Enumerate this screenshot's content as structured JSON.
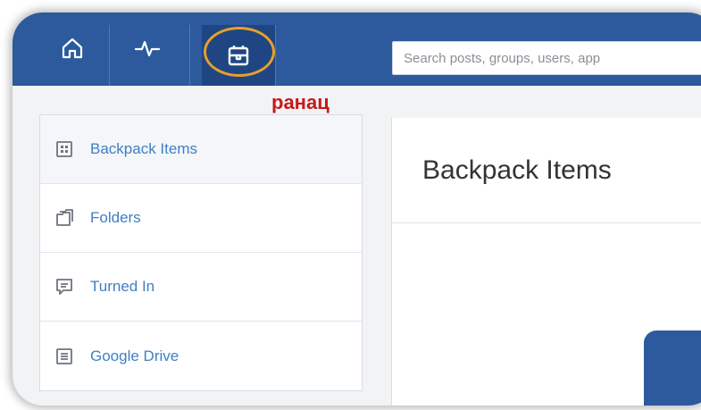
{
  "header": {
    "nav": [
      {
        "name": "home",
        "icon": "home-icon"
      },
      {
        "name": "activity",
        "icon": "activity-pulse-icon"
      },
      {
        "name": "backpack",
        "icon": "backpack-icon"
      }
    ],
    "search_placeholder": "Search posts, groups, users, app"
  },
  "annotation": {
    "text": "ранац",
    "color": "#c8191a",
    "ring_color": "#e7a02a"
  },
  "sidebar": {
    "items": [
      {
        "label": "Backpack Items",
        "icon": "grid-icon",
        "active": true
      },
      {
        "label": "Folders",
        "icon": "folders-icon",
        "active": false
      },
      {
        "label": "Turned In",
        "icon": "comment-icon",
        "active": false
      },
      {
        "label": "Google Drive",
        "icon": "document-icon",
        "active": false
      }
    ]
  },
  "main": {
    "title": "Backpack Items"
  },
  "colors": {
    "brand": "#2c5a9d",
    "link": "#3f7fc4"
  }
}
